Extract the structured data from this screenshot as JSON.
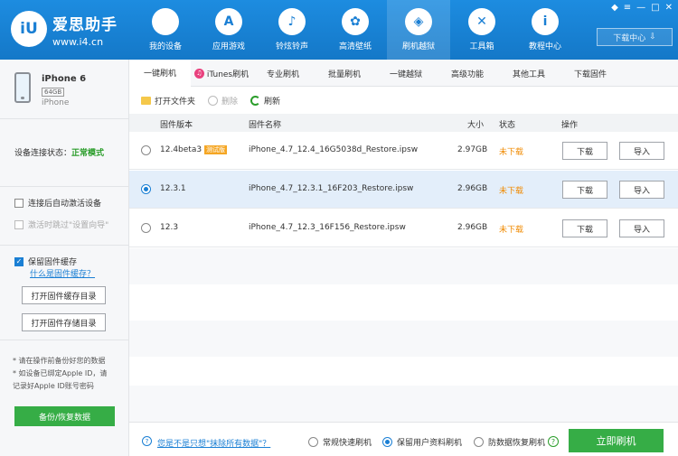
{
  "brand": {
    "logo": "iU",
    "name": "爱思助手",
    "url": "www.i4.cn"
  },
  "nav": [
    {
      "label": "我的设备",
      "icon": "apple-icon",
      "glyph": ""
    },
    {
      "label": "应用游戏",
      "icon": "appstore-icon",
      "glyph": "A"
    },
    {
      "label": "铃炫铃声",
      "icon": "bell-icon",
      "glyph": "♪"
    },
    {
      "label": "高清壁纸",
      "icon": "flower-icon",
      "glyph": "✿"
    },
    {
      "label": "刷机越狱",
      "icon": "box-icon",
      "glyph": "◈"
    },
    {
      "label": "工具箱",
      "icon": "tools-icon",
      "glyph": "✕"
    },
    {
      "label": "教程中心",
      "icon": "info-icon",
      "glyph": "i"
    }
  ],
  "window_controls": {
    "skin": "◆",
    "list": "≡",
    "min": "—",
    "max": "□",
    "close": "✕"
  },
  "download_center": "下载中心",
  "device": {
    "name": "iPhone 6",
    "capacity": "64GB",
    "model": "iPhone"
  },
  "sidebar": {
    "conn_label": "设备连接状态：",
    "conn_value": "正常模式",
    "auto_activate": "连接后自动激活设备",
    "skip_setup": "激活时跳过\"设置向导\"",
    "keep_firmware": "保留固件缓存",
    "what_is_cache": "什么是固件缓存？",
    "open_cache_btn": "打开固件缓存目录",
    "open_store_btn": "打开固件存储目录",
    "notes": [
      "* 请在操作前备份好您的数据",
      "* 如设备已绑定Apple ID，请",
      "  记录好Apple ID账号密码"
    ],
    "backup_btn": "备份/恢复数据"
  },
  "tabs": [
    "一键刷机",
    "iTunes刷机",
    "专业刷机",
    "批量刷机",
    "一键越狱",
    "高级功能",
    "其他工具",
    "下载固件"
  ],
  "toolbar": {
    "open_folder": "打开文件夹",
    "delete": "删除",
    "refresh": "刷新"
  },
  "table": {
    "headers": {
      "version": "固件版本",
      "name": "固件名称",
      "size": "大小",
      "status": "状态",
      "action": "操作"
    },
    "rows": [
      {
        "version": "12.4beta3",
        "badge": "测试版",
        "name": "iPhone_4.7_12.4_16G5038d_Restore.ipsw",
        "size": "2.97GB",
        "status": "未下载",
        "download": "下载",
        "import": "导入",
        "selected": false
      },
      {
        "version": "12.3.1",
        "badge": "",
        "name": "iPhone_4.7_12.3.1_16F203_Restore.ipsw",
        "size": "2.96GB",
        "status": "未下载",
        "download": "下载",
        "import": "导入",
        "selected": true
      },
      {
        "version": "12.3",
        "badge": "",
        "name": "iPhone_4.7_12.3_16F156_Restore.ipsw",
        "size": "2.96GB",
        "status": "未下载",
        "download": "下载",
        "import": "导入",
        "selected": false
      }
    ]
  },
  "footer": {
    "help_link": "您是不是只想\"抹除所有数据\"？",
    "options": [
      "常规快速刷机",
      "保留用户资料刷机",
      "防数据恢复刷机"
    ],
    "flash_btn": "立即刷机"
  },
  "colors": {
    "primary": "#1a7fd4",
    "green": "#36ad46",
    "orange": "#f08a00",
    "badge": "#f5a623"
  }
}
